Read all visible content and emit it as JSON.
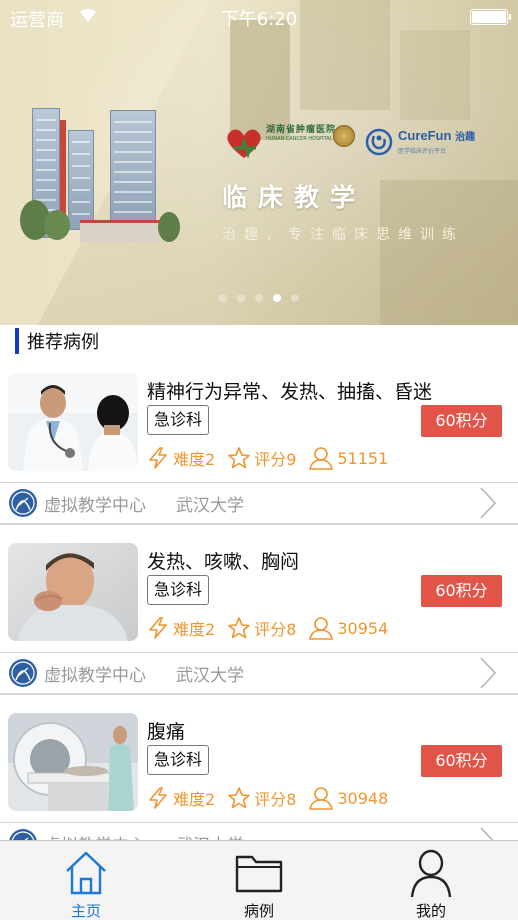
{
  "status_bar": {
    "carrier": "运营商",
    "time": "下午6:20"
  },
  "banner": {
    "hospital_name": "湖南省肿瘤医院",
    "hospital_name_en": "HUNAN CANCER HOSPITAL",
    "brand_en": "CureFun",
    "brand_zh": "治趣",
    "brand_sub": "医学临床评价平台",
    "title": "临床教学",
    "subtitle": "治趣，专注临床思维训练",
    "page_count": 5,
    "active_index": 3
  },
  "section": {
    "title": "推荐病例"
  },
  "cases": [
    {
      "title": "精神行为异常、发热、抽搐、昏迷",
      "dept": "急诊科",
      "points": "60积分",
      "difficulty": "难度2",
      "rating": "评分9",
      "views": "51151",
      "org": "虚拟教学中心",
      "university": "武汉大学",
      "thumb": "doctor-stethoscope-photo"
    },
    {
      "title": "发热、咳嗽、胸闷",
      "dept": "急诊科",
      "points": "60积分",
      "difficulty": "难度2",
      "rating": "评分8",
      "views": "30954",
      "org": "虚拟教学中心",
      "university": "武汉大学",
      "thumb": "coughing-man-photo"
    },
    {
      "title": "腹痛",
      "dept": "急诊科",
      "points": "60积分",
      "difficulty": "难度2",
      "rating": "评分8",
      "views": "30948",
      "org": "虚拟教学中心",
      "university": "武汉大学",
      "thumb": "ct-scanner-photo"
    }
  ],
  "tabs": [
    {
      "label": "主页",
      "icon": "home-icon",
      "active": true
    },
    {
      "label": "病例",
      "icon": "folder-icon",
      "active": false
    },
    {
      "label": "我的",
      "icon": "person-icon",
      "active": false
    }
  ],
  "colors": {
    "accent_blue": "#1a79d6",
    "section_bar": "#1b35d0",
    "points_red": "#e25447",
    "meta_orange": "#f0962f"
  }
}
